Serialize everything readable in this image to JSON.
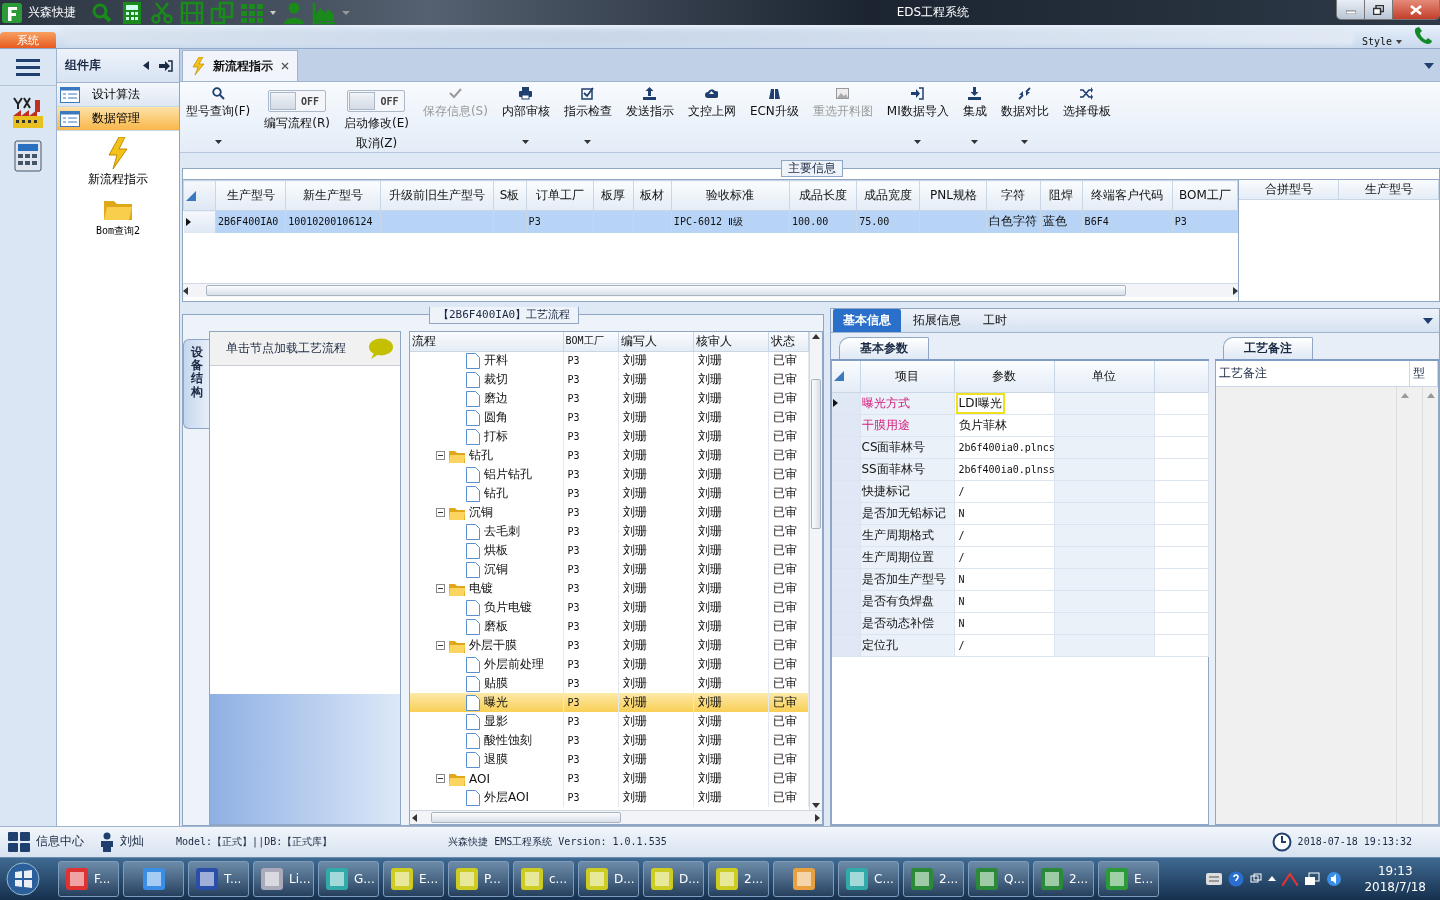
{
  "window": {
    "app_name": "兴森快捷",
    "title": "EDS工程系统"
  },
  "ribbon": {
    "tabs": [
      {
        "label": "系统",
        "selected": true
      }
    ],
    "style_menu": "Style"
  },
  "component_library": {
    "title": "组件库",
    "items": [
      {
        "label": "设计算法",
        "selected": false
      },
      {
        "label": "数据管理",
        "selected": true
      }
    ],
    "tools": [
      {
        "label": "新流程指示"
      },
      {
        "label": "Bom查询2"
      }
    ]
  },
  "document_tabs": [
    {
      "label": "新流程指示",
      "selected": true
    }
  ],
  "toolbar": [
    {
      "kind": "button",
      "label": "型号查询(F)",
      "disabled": false,
      "dropdown": true
    },
    {
      "kind": "toggle",
      "state": "OFF",
      "on": false,
      "label": "编写流程(R)"
    },
    {
      "kind": "toggle",
      "state": "OFF",
      "on": false,
      "label": "启动修改(E)",
      "second_line": "取消(Z)"
    },
    {
      "kind": "button",
      "label": "保存信息(S)",
      "disabled": true,
      "dropdown": false
    },
    {
      "kind": "button",
      "label": "内部审核",
      "disabled": false,
      "dropdown": true
    },
    {
      "kind": "button",
      "label": "指示检查",
      "disabled": false,
      "dropdown": true
    },
    {
      "kind": "button",
      "label": "发送指示",
      "disabled": false,
      "dropdown": false
    },
    {
      "kind": "button",
      "label": "文控上网",
      "disabled": false,
      "dropdown": false
    },
    {
      "kind": "button",
      "label": "ECN升级",
      "disabled": false,
      "dropdown": false
    },
    {
      "kind": "button",
      "label": "重选开料图",
      "disabled": true,
      "dropdown": false
    },
    {
      "kind": "button",
      "label": "MI数据导入",
      "disabled": false,
      "dropdown": true
    },
    {
      "kind": "button",
      "label": "集成",
      "disabled": false,
      "dropdown": true
    },
    {
      "kind": "button",
      "label": "数据对比",
      "disabled": false,
      "dropdown": true
    },
    {
      "kind": "button",
      "label": "选择母板",
      "disabled": false,
      "dropdown": false
    }
  ],
  "main_info": {
    "title": "主要信息",
    "columns": [
      "生产型号",
      "新生产型号",
      "升级前旧生产型号",
      "S板",
      "订单工厂",
      "板厚",
      "板材",
      "验收标准",
      "成品长度",
      "成品宽度",
      "PNL规格",
      "字符",
      "阻焊",
      "终端客户代码",
      "BOM工厂"
    ],
    "rows": [
      {
        "cells": [
          "2B6F400IA0",
          "10010200106124",
          null,
          null,
          "P3",
          null,
          null,
          "IPC-6012 Ⅱ级",
          "100.00",
          "75.00",
          null,
          "白色字符",
          "蓝色",
          "B6F4",
          "P3"
        ],
        "selected": true
      }
    ],
    "side_columns": [
      "合拼型号",
      "生产型号"
    ]
  },
  "process": {
    "title": "【2B6F400IA0】工艺流程",
    "side_tab": "设备结构",
    "hint": "单击节点加载工艺流程",
    "columns": [
      "流程",
      "BOM工厂",
      "编写人",
      "核审人",
      "状态"
    ],
    "tree": [
      {
        "kind": "file",
        "label": "开料",
        "bom": "P3",
        "writer": "刘珊",
        "reviewer": "刘珊",
        "status": "已审",
        "selected": false
      },
      {
        "kind": "file",
        "label": "裁切",
        "bom": "P3",
        "writer": "刘珊",
        "reviewer": "刘珊",
        "status": "已审",
        "selected": false
      },
      {
        "kind": "file",
        "label": "磨边",
        "bom": "P3",
        "writer": "刘珊",
        "reviewer": "刘珊",
        "status": "已审",
        "selected": false
      },
      {
        "kind": "file",
        "label": "圆角",
        "bom": "P3",
        "writer": "刘珊",
        "reviewer": "刘珊",
        "status": "已审",
        "selected": false
      },
      {
        "kind": "file",
        "label": "打标",
        "bom": "P3",
        "writer": "刘珊",
        "reviewer": "刘珊",
        "status": "已审",
        "selected": false
      },
      {
        "kind": "folder",
        "label": "钻孔",
        "bom": "P3",
        "writer": "刘珊",
        "reviewer": "刘珊",
        "status": "已审",
        "selected": false,
        "expanded": true,
        "children": [
          {
            "kind": "file",
            "label": "铝片钻孔",
            "bom": "P3",
            "writer": "刘珊",
            "reviewer": "刘珊",
            "status": "已审",
            "selected": false
          },
          {
            "kind": "file",
            "label": "钻孔",
            "bom": "P3",
            "writer": "刘珊",
            "reviewer": "刘珊",
            "status": "已审",
            "selected": false
          }
        ]
      },
      {
        "kind": "folder",
        "label": "沉铜",
        "bom": "P3",
        "writer": "刘珊",
        "reviewer": "刘珊",
        "status": "已审",
        "selected": false,
        "expanded": true,
        "children": [
          {
            "kind": "file",
            "label": "去毛刺",
            "bom": "P3",
            "writer": "刘珊",
            "reviewer": "刘珊",
            "status": "已审",
            "selected": false
          },
          {
            "kind": "file",
            "label": "烘板",
            "bom": "P3",
            "writer": "刘珊",
            "reviewer": "刘珊",
            "status": "已审",
            "selected": false
          },
          {
            "kind": "file",
            "label": "沉铜",
            "bom": "P3",
            "writer": "刘珊",
            "reviewer": "刘珊",
            "status": "已审",
            "selected": false
          }
        ]
      },
      {
        "kind": "folder",
        "label": "电镀",
        "bom": "P3",
        "writer": "刘珊",
        "reviewer": "刘珊",
        "status": "已审",
        "selected": false,
        "expanded": true,
        "children": [
          {
            "kind": "file",
            "label": "负片电镀",
            "bom": "P3",
            "writer": "刘珊",
            "reviewer": "刘珊",
            "status": "已审",
            "selected": false
          },
          {
            "kind": "file",
            "label": "磨板",
            "bom": "P3",
            "writer": "刘珊",
            "reviewer": "刘珊",
            "status": "已审",
            "selected": false
          }
        ]
      },
      {
        "kind": "folder",
        "label": "外层干膜",
        "bom": "P3",
        "writer": "刘珊",
        "reviewer": "刘珊",
        "status": "已审",
        "selected": false,
        "expanded": true,
        "children": [
          {
            "kind": "file",
            "label": "外层前处理",
            "bom": "P3",
            "writer": "刘珊",
            "reviewer": "刘珊",
            "status": "已审",
            "selected": false
          },
          {
            "kind": "file",
            "label": "贴膜",
            "bom": "P3",
            "writer": "刘珊",
            "reviewer": "刘珊",
            "status": "已审",
            "selected": false
          },
          {
            "kind": "file",
            "label": "曝光",
            "bom": "P3",
            "writer": "刘珊",
            "reviewer": "刘珊",
            "status": "已审",
            "selected": true
          },
          {
            "kind": "file",
            "label": "显影",
            "bom": "P3",
            "writer": "刘珊",
            "reviewer": "刘珊",
            "status": "已审",
            "selected": false
          },
          {
            "kind": "file",
            "label": "酸性蚀刻",
            "bom": "P3",
            "writer": "刘珊",
            "reviewer": "刘珊",
            "status": "已审",
            "selected": false
          },
          {
            "kind": "file",
            "label": "退膜",
            "bom": "P3",
            "writer": "刘珊",
            "reviewer": "刘珊",
            "status": "已审",
            "selected": false
          }
        ]
      },
      {
        "kind": "folder",
        "label": "AOI",
        "bom": "P3",
        "writer": "刘珊",
        "reviewer": "刘珊",
        "status": "已审",
        "selected": false,
        "expanded": true,
        "children": [
          {
            "kind": "file",
            "label": "外层AOI",
            "bom": "P3",
            "writer": "刘珊",
            "reviewer": "刘珊",
            "status": "已审",
            "selected": false
          }
        ]
      }
    ]
  },
  "details": {
    "tabs": [
      {
        "label": "基本信息",
        "selected": true
      },
      {
        "label": "拓展信息",
        "selected": false
      },
      {
        "label": "工时",
        "selected": false
      }
    ],
    "params": {
      "tab": "基本参数",
      "columns": [
        "项目",
        "参数",
        "单位"
      ],
      "rows": [
        {
          "item": "曝光方式",
          "value": "LDI曝光",
          "highlighted": true,
          "current": true
        },
        {
          "item": "干膜用途",
          "value": "负片菲林",
          "highlighted": true,
          "current": false
        },
        {
          "item": "CS面菲林号",
          "value": "2b6f400ia0.plncs",
          "highlighted": false,
          "current": false
        },
        {
          "item": "SS面菲林号",
          "value": "2b6f400ia0.plnss",
          "highlighted": false,
          "current": false
        },
        {
          "item": "快捷标记",
          "value": "/",
          "highlighted": false,
          "current": false
        },
        {
          "item": "是否加无铅标记",
          "value": "N",
          "highlighted": false,
          "current": false
        },
        {
          "item": "生产周期格式",
          "value": "/",
          "highlighted": false,
          "current": false
        },
        {
          "item": "生产周期位置",
          "value": "/",
          "highlighted": false,
          "current": false
        },
        {
          "item": "是否加生产型号",
          "value": "N",
          "highlighted": false,
          "current": false
        },
        {
          "item": "是否有负焊盘",
          "value": "N",
          "highlighted": false,
          "current": false
        },
        {
          "item": "是否动态补偿",
          "value": "N",
          "highlighted": false,
          "current": false
        },
        {
          "item": "定位孔",
          "value": "/",
          "highlighted": false,
          "current": false
        }
      ]
    },
    "notes": {
      "tab": "工艺备注",
      "columns": [
        "工艺备注",
        "型"
      ]
    }
  },
  "status_bar": {
    "info_center": "信息中心",
    "user": "刘灿",
    "environment": "Model:【正式】||DB:【正式库】",
    "app_version": "兴森快捷 EMS工程系统 Version: 1.0.1.535",
    "datetime": "2018-07-18 19:13:32"
  },
  "taskbar": {
    "items": [
      {
        "kind": "app",
        "label": "F..."
      },
      {
        "kind": "icon"
      },
      {
        "kind": "app",
        "label": "T..."
      },
      {
        "kind": "app",
        "label": "Li..."
      },
      {
        "kind": "app",
        "label": "G..."
      },
      {
        "kind": "app",
        "label": "E..."
      },
      {
        "kind": "app",
        "label": "P..."
      },
      {
        "kind": "app",
        "label": "c..."
      },
      {
        "kind": "app",
        "label": "D..."
      },
      {
        "kind": "app",
        "label": "D..."
      },
      {
        "kind": "app",
        "label": "2..."
      },
      {
        "kind": "icon"
      },
      {
        "kind": "app",
        "label": "C..."
      },
      {
        "kind": "app",
        "label": "2..."
      },
      {
        "kind": "app",
        "label": "Q..."
      },
      {
        "kind": "app",
        "label": "2..."
      },
      {
        "kind": "app",
        "label": "E..."
      }
    ],
    "time": "19:13",
    "date": "2018/7/18"
  }
}
